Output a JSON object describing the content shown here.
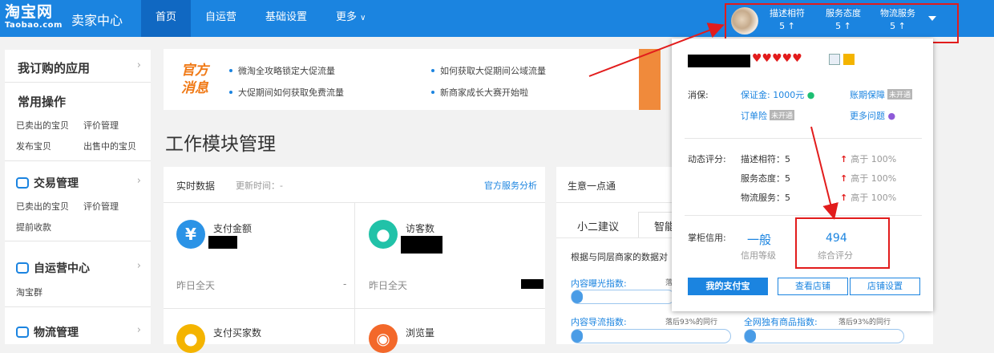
{
  "header": {
    "logo_cn": "淘宝网",
    "logo_en": "Taobao.com",
    "brand": "卖家中心",
    "nav": [
      "首页",
      "自运营",
      "基础设置",
      "更多"
    ],
    "ratings": [
      {
        "label": "描述相符",
        "value": "5 ↑"
      },
      {
        "label": "服务态度",
        "value": "5 ↑"
      },
      {
        "label": "物流服务",
        "value": "5 ↑"
      }
    ]
  },
  "sidebar": {
    "subscribed": "我订购的应用",
    "common_ops": "常用操作",
    "common_links": [
      "已卖出的宝贝",
      "评价管理",
      "发布宝贝",
      "出售中的宝贝"
    ],
    "trade": {
      "title": "交易管理",
      "links": [
        "已卖出的宝贝",
        "评价管理",
        "提前收款"
      ]
    },
    "selfop": {
      "title": "自运营中心",
      "links": [
        "淘宝群"
      ]
    },
    "logistics": {
      "title": "物流管理"
    }
  },
  "news": {
    "badge_line1": "官方",
    "badge_line2": "消息",
    "items": [
      "微淘全攻略锁定大促流量",
      "如何获取大促期间公域流量",
      "大促期间如何获取免费流量",
      "新商家成长大赛开始啦"
    ]
  },
  "workspace": {
    "title": "工作模块管理"
  },
  "realtime": {
    "title": "实时数据",
    "update_label": "更新时间：-",
    "link": "官方服务分析",
    "metrics": [
      {
        "label": "支付金额",
        "icon": "yen-icon",
        "sub": "昨日全天"
      },
      {
        "label": "访客数",
        "icon": "footprint-icon",
        "sub": "昨日全天"
      },
      {
        "label": "支付买家数",
        "icon": "buyer-icon"
      },
      {
        "label": "浏览量",
        "icon": "eye-icon"
      }
    ],
    "sub_dash": "-"
  },
  "business": {
    "title": "生意一点通",
    "tabs": [
      "小二建议",
      "智能"
    ],
    "desc": "根据与同层商家的数据对",
    "bars": [
      {
        "label": "内容曝光指数:",
        "note": "落"
      },
      {
        "label": "内容导流指数:",
        "note": "落后93%的同行"
      },
      {
        "label": "全网独有商品指数:",
        "note": "落后93%的同行"
      }
    ]
  },
  "popup": {
    "guarantee_label": "消保:",
    "deposit": "保证金: 1000元",
    "insurance": "订单险",
    "insurance_tag": "未开通",
    "account_protect": "账期保障",
    "account_tag": "未开通",
    "more_questions": "更多问题",
    "dynamic_label": "动态评分:",
    "scores": [
      {
        "label": "描述相符：5",
        "cmp": "高于 100%"
      },
      {
        "label": "服务态度：5",
        "cmp": "高于 100%"
      },
      {
        "label": "物流服务：5",
        "cmp": "高于 100%"
      }
    ],
    "credit_label": "掌柜信用:",
    "credit_level": "一般",
    "credit_level_caption": "信用等级",
    "credit_score": "494",
    "credit_score_caption": "综合评分",
    "buttons": [
      "我的支付宝",
      "查看店铺",
      "店铺设置"
    ]
  }
}
